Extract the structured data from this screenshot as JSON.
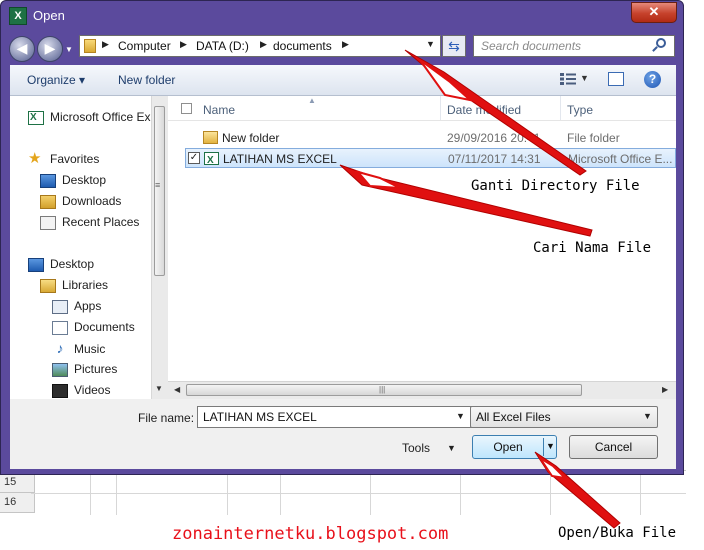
{
  "window": {
    "title": "Open",
    "close_label": "✕"
  },
  "address": {
    "crumbs": [
      "Computer",
      "DATA (D:)",
      "documents"
    ]
  },
  "search": {
    "placeholder": "Search documents"
  },
  "toolbar": {
    "organize_label": "Organize ▾",
    "new_folder_label": "New folder"
  },
  "nav": {
    "items": [
      {
        "label": "Microsoft Office Ex",
        "icon": "excel-icon"
      },
      {
        "label": "Favorites",
        "icon": "star-icon"
      },
      {
        "label": "Desktop",
        "icon": "desktop-icon"
      },
      {
        "label": "Downloads",
        "icon": "downloads-icon"
      },
      {
        "label": "Recent Places",
        "icon": "recent-places-icon"
      },
      {
        "label": "Desktop",
        "icon": "desktop-icon"
      },
      {
        "label": "Libraries",
        "icon": "libraries-icon"
      },
      {
        "label": "Apps",
        "icon": "apps-icon"
      },
      {
        "label": "Documents",
        "icon": "documents-icon"
      },
      {
        "label": "Music",
        "icon": "music-icon"
      },
      {
        "label": "Pictures",
        "icon": "pictures-icon"
      },
      {
        "label": "Videos",
        "icon": "videos-icon"
      }
    ]
  },
  "file_list": {
    "columns": [
      "Name",
      "Date modified",
      "Type"
    ],
    "rows": [
      {
        "name": "New folder",
        "date": "29/09/2016 20:41",
        "type": "File folder",
        "icon": "folder-icon",
        "selected": false
      },
      {
        "name": "LATIHAN MS EXCEL",
        "date": "07/11/2017 14:31",
        "type": "Microsoft Office E...",
        "icon": "excel-file-icon",
        "selected": true
      }
    ]
  },
  "bottom": {
    "file_name_label": "File name:",
    "file_name_value": "LATIHAN MS EXCEL",
    "filter_value": "All Excel Files",
    "tools_label": "Tools",
    "open_label": "Open",
    "cancel_label": "Cancel"
  },
  "excel_rows": [
    "15",
    "16"
  ],
  "annotations": {
    "directory": "Ganti Directory File",
    "filename": "Cari Nama File",
    "open": "Open/Buka File",
    "watermark": "zonainternetku.blogspot.com"
  },
  "colors": {
    "frame": "#5b4a9d",
    "arrow": "#e01010",
    "watermark": "#e8101a"
  }
}
